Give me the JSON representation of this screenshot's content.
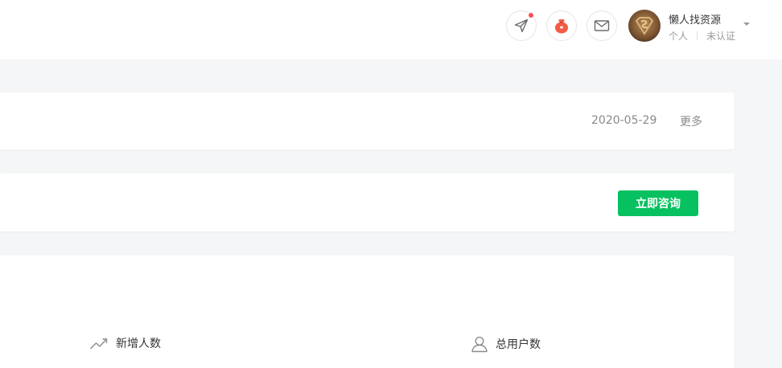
{
  "header": {
    "user": {
      "name": "懒人找资源",
      "account_type": "个人",
      "verify_status": "未认证"
    },
    "icons": [
      "send-icon",
      "money-bag-icon",
      "mail-icon",
      "dropdown-caret-icon"
    ],
    "colors": {
      "notification_dot": "#fa5151",
      "primary": "#07c160"
    }
  },
  "notice": {
    "date": "2020-05-29",
    "more_label": "更多"
  },
  "consult": {
    "button_label": "立即咨询"
  },
  "stats": {
    "new_users_label": "新增人数",
    "total_users_label": "总用户数"
  }
}
